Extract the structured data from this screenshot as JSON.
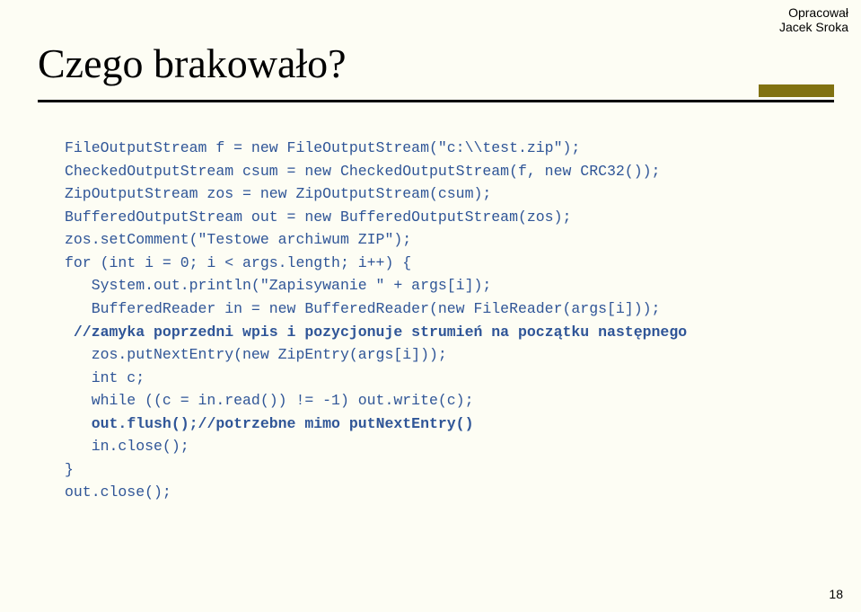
{
  "credit": {
    "line1": "Opracował",
    "line2": "Jacek Sroka"
  },
  "title": "Czego brakowało?",
  "code": {
    "l01": "FileOutputStream f = new FileOutputStream(\"c:\\\\test.zip\");",
    "l02": "CheckedOutputStream csum = new CheckedOutputStream(f, new CRC32());",
    "l03": "ZipOutputStream zos = new ZipOutputStream(csum);",
    "l04": "BufferedOutputStream out = new BufferedOutputStream(zos);",
    "l05": "zos.setComment(\"Testowe archiwum ZIP\");",
    "l06": "for (int i = 0; i < args.length; i++) {",
    "l07": "   System.out.println(\"Zapisywanie \" + args[i]);",
    "l08": "   BufferedReader in = new BufferedReader(new FileReader(args[i]));",
    "l09_pre": " ",
    "l09_bold": "//zamyka poprzedni wpis i pozycjonuje strumień na początku następnego",
    "l10": "   zos.putNextEntry(new ZipEntry(args[i]));",
    "l11": "   int c;",
    "l12": "   while ((c = in.read()) != -1) out.write(c);",
    "l13_pre": "   ",
    "l13_bold": "out.flush();//potrzebne mimo putNextEntry()",
    "l14": "   in.close();",
    "l15": "}",
    "l16": "out.close();"
  },
  "pagenum": "18"
}
